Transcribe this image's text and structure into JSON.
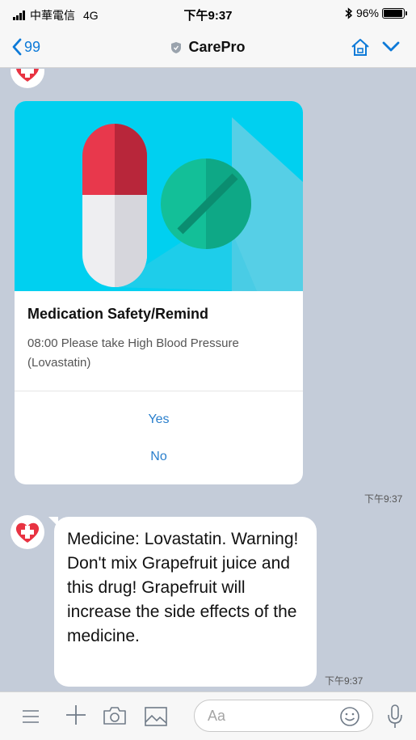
{
  "status_bar": {
    "carrier": "中華電信",
    "network": "4G",
    "time": "下午9:37",
    "bluetooth": "bluetooth-icon",
    "battery_percent": "96%",
    "battery_level": 0.96
  },
  "nav": {
    "back_count": "99",
    "title": "CarePro",
    "icons": [
      "chevron-left-icon",
      "shield-icon",
      "home-icon",
      "chevron-down-icon"
    ]
  },
  "messages": {
    "card": {
      "title": "Medication Safety/Remind",
      "body": "08:00 Please take High Blood Pressure (Lovastatin)",
      "actions": [
        "Yes",
        "No"
      ],
      "time": "下午9:37"
    },
    "text_message": {
      "text": "Medicine: Lovastatin. Warning! Don't mix Grapefruit juice and this drug! Grapefruit will increase the side effects of the medicine.",
      "time": "下午9:37"
    }
  },
  "input_bar": {
    "placeholder": "Aa",
    "icons": [
      "menu-icon",
      "plus-icon",
      "camera-icon",
      "image-icon",
      "emoji-icon",
      "microphone-icon"
    ]
  },
  "colors": {
    "accent": "#0d7ad8",
    "chat_background": "#c4ccd9",
    "card_image_background": "#00d0f0",
    "pill_red": "#e8384c",
    "tablet_green": "#13bf98"
  }
}
